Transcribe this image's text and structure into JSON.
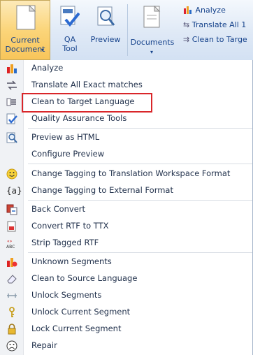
{
  "ribbon": {
    "current_document": "Current Document",
    "qa_tool": "QA Tool",
    "preview": "Preview",
    "documents": "Documents",
    "analyze": "Analyze",
    "translate_all": "Translate All 1",
    "clean_to_target": "Clean to Targe"
  },
  "menu": {
    "items": [
      {
        "label": "Analyze",
        "icon": "analyze-icon"
      },
      {
        "label": "Translate All Exact matches",
        "icon": "translate-icon"
      },
      {
        "label": "Clean to Target Language",
        "icon": "clean-target-icon"
      },
      {
        "label": "Quality Assurance Tools",
        "icon": "qa-icon"
      },
      {
        "label": "Preview as HTML",
        "icon": "preview-icon"
      },
      {
        "label": "Configure Preview",
        "icon": ""
      },
      {
        "label": "Change Tagging to Translation Workspace Format",
        "icon": "smiley-icon"
      },
      {
        "label": "Change Tagging to External Format",
        "icon": "tag-icon"
      },
      {
        "label": "Back Convert",
        "icon": "back-convert-icon"
      },
      {
        "label": "Convert RTF to TTX",
        "icon": "convert-icon"
      },
      {
        "label": "Strip Tagged RTF",
        "icon": "strip-icon"
      },
      {
        "label": "Unknown Segments",
        "icon": "unknown-icon"
      },
      {
        "label": "Clean to Source Language",
        "icon": "eraser-icon"
      },
      {
        "label": "Unlock Segments",
        "icon": "unlock-icon"
      },
      {
        "label": "Unlock Current Segment",
        "icon": "key-icon"
      },
      {
        "label": "Lock Current Segment",
        "icon": "lock-icon"
      },
      {
        "label": "Repair",
        "icon": "repair-icon"
      }
    ]
  },
  "colors": {
    "accent": "#d9262a",
    "ribbon_text": "#15428b"
  }
}
